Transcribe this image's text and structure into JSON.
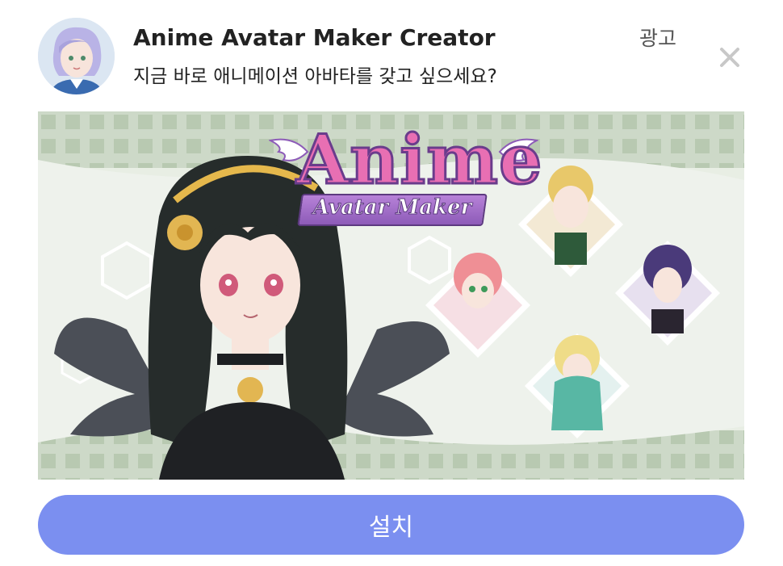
{
  "ad": {
    "app_name": "Anime Avatar Maker Creator",
    "description": "지금 바로 애니메이션 아바타를 갖고 싶으세요?",
    "ad_label": "광고",
    "close_icon": "close-icon",
    "install_label": "설치",
    "colors": {
      "install_button": "#7b8ff0",
      "banner_background": "#e9efe6",
      "logo_pink": "#e86fb3",
      "logo_purple": "#8d5bb8"
    }
  },
  "banner": {
    "logo_title": "Anime",
    "logo_subtitle": "Avatar Maker"
  }
}
